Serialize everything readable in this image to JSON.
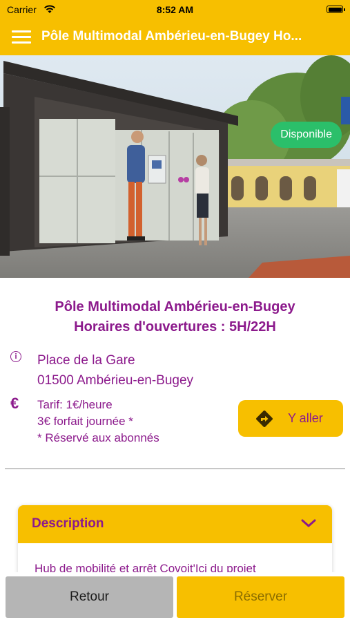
{
  "status_bar": {
    "carrier": "Carrier",
    "time": "8:52 AM"
  },
  "nav": {
    "title": "Pôle Multimodal Ambérieu-en-Bugey Ho..."
  },
  "hero": {
    "badge": "Disponible"
  },
  "station": {
    "title_line1": "Pôle Multimodal Ambérieu-en-Bugey",
    "title_line2": "Horaires d'ouvertures : 5H/22H",
    "address_line1": "Place de la Gare",
    "address_line2": "01500 Ambérieu-en-Bugey",
    "price_symbol": "€",
    "price_line1": "Tarif: 1€/heure",
    "price_line2": "3€ forfait journée *",
    "price_line3": "* Réservé aux abonnés",
    "go_label": "Y aller"
  },
  "description": {
    "title": "Description",
    "text": "Hub de mobilité et arrêt Covoit'Ici du projet"
  },
  "actions": {
    "back_label": "Retour",
    "reserve_label": "Réserver"
  },
  "colors": {
    "accent": "#f7bf00",
    "text_purple": "#8c1a8c",
    "available_green": "#2bbf6a",
    "back_grey": "#b5b5b5"
  }
}
